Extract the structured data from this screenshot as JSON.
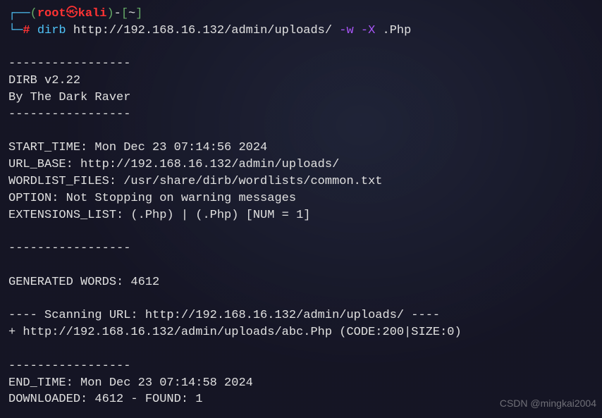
{
  "prompt": {
    "corner_top": "┌──",
    "paren_open": "(",
    "user": "root",
    "skull": "㉿",
    "host": "kali",
    "paren_close": ")",
    "dash": "-",
    "bracket_open": "[",
    "cwd": "~",
    "bracket_close": "]",
    "corner_bottom": "└─",
    "hash": "#",
    "command": "dirb",
    "url_arg": "http://192.168.16.132/admin/uploads/",
    "flag_w": "-w",
    "flag_x": "-X",
    "ext_arg": ".Php"
  },
  "output": {
    "sep": "-----------------",
    "banner1": "DIRB v2.22    ",
    "banner2": "By The Dark Raver",
    "start_time": "START_TIME: Mon Dec 23 07:14:56 2024",
    "url_base": "URL_BASE: http://192.168.16.132/admin/uploads/",
    "wordlist": "WORDLIST_FILES: /usr/share/dirb/wordlists/common.txt",
    "option": "OPTION: Not Stopping on warning messages",
    "extensions": "EXTENSIONS_LIST: (.Php) | (.Php) [NUM = 1]",
    "gen_words": "GENERATED WORDS: 4612                                                          ",
    "scanning": "---- Scanning URL: http://192.168.16.132/admin/uploads/ ----",
    "found": "+ http://192.168.16.132/admin/uploads/abc.Php (CODE:200|SIZE:0)                        ",
    "end_time": "END_TIME: Mon Dec 23 07:14:58 2024",
    "downloaded": "DOWNLOADED: 4612 - FOUND: 1"
  },
  "watermark": "CSDN @mingkai2004"
}
